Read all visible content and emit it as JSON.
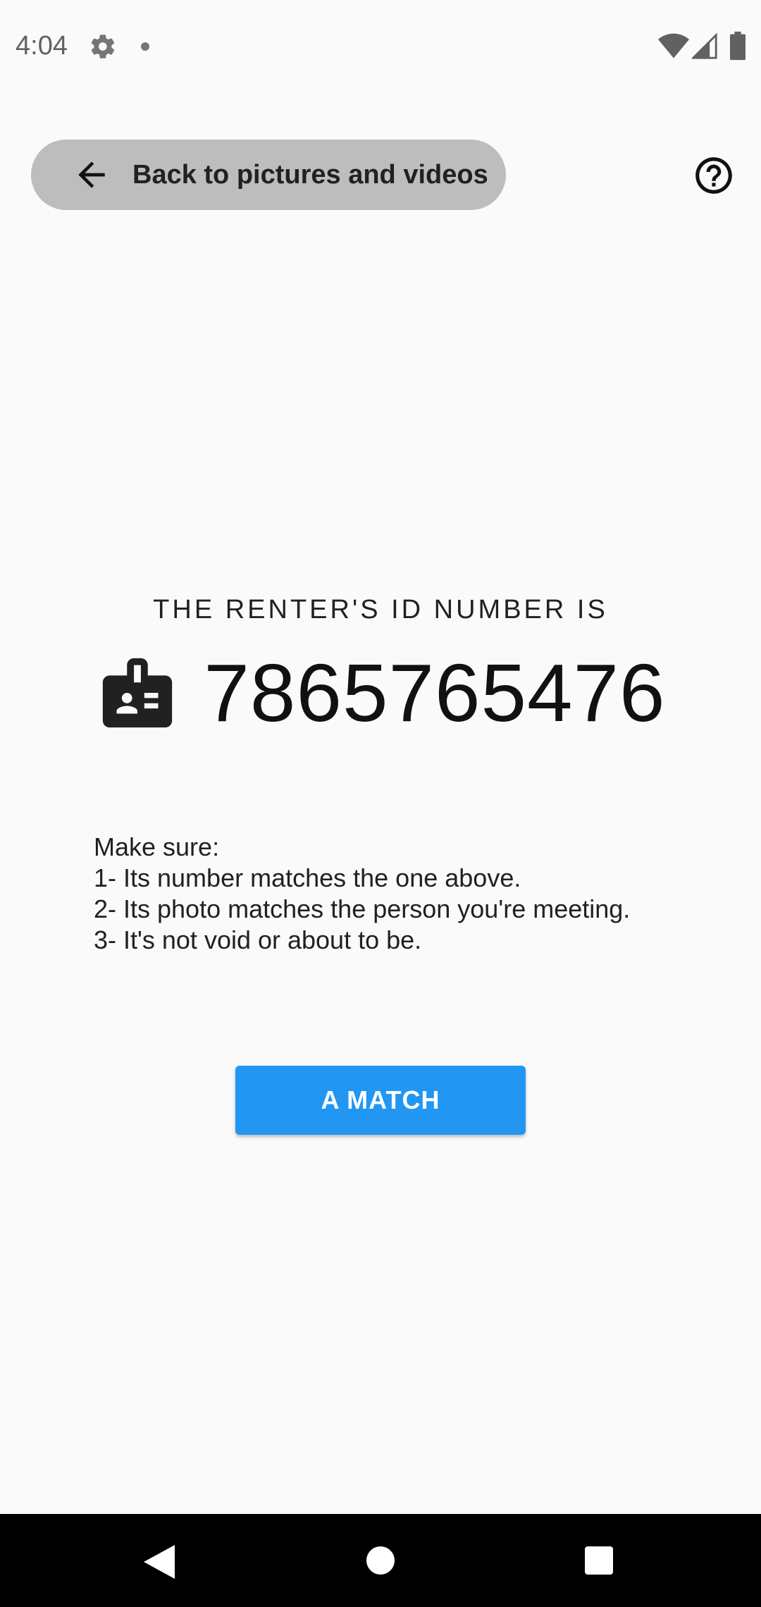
{
  "status_bar": {
    "time": "4:04",
    "icons": [
      "gear-icon",
      "notification-dot-icon",
      "wifi-icon",
      "signal-icon",
      "battery-icon"
    ]
  },
  "top_bar": {
    "back_label": "Back to pictures and videos",
    "back_icon": "arrow-left-icon",
    "help_icon": "help-circle-icon"
  },
  "main": {
    "heading": "THE RENTER'S ID NUMBER IS",
    "id_icon": "id-badge-icon",
    "id_number": "7865765476",
    "instructions": [
      "Make sure:",
      "1- Its number matches the one above.",
      "2- Its photo matches the person you're meeting.",
      "3- It's not void or about to be."
    ],
    "match_button_label": "A MATCH"
  },
  "nav_bar": {
    "icons": [
      "nav-back-icon",
      "nav-home-icon",
      "nav-recents-icon"
    ]
  },
  "colors": {
    "background": "#fafafa",
    "pill": "#bdbdbd",
    "accent": "#2196f3",
    "text": "#212121"
  }
}
